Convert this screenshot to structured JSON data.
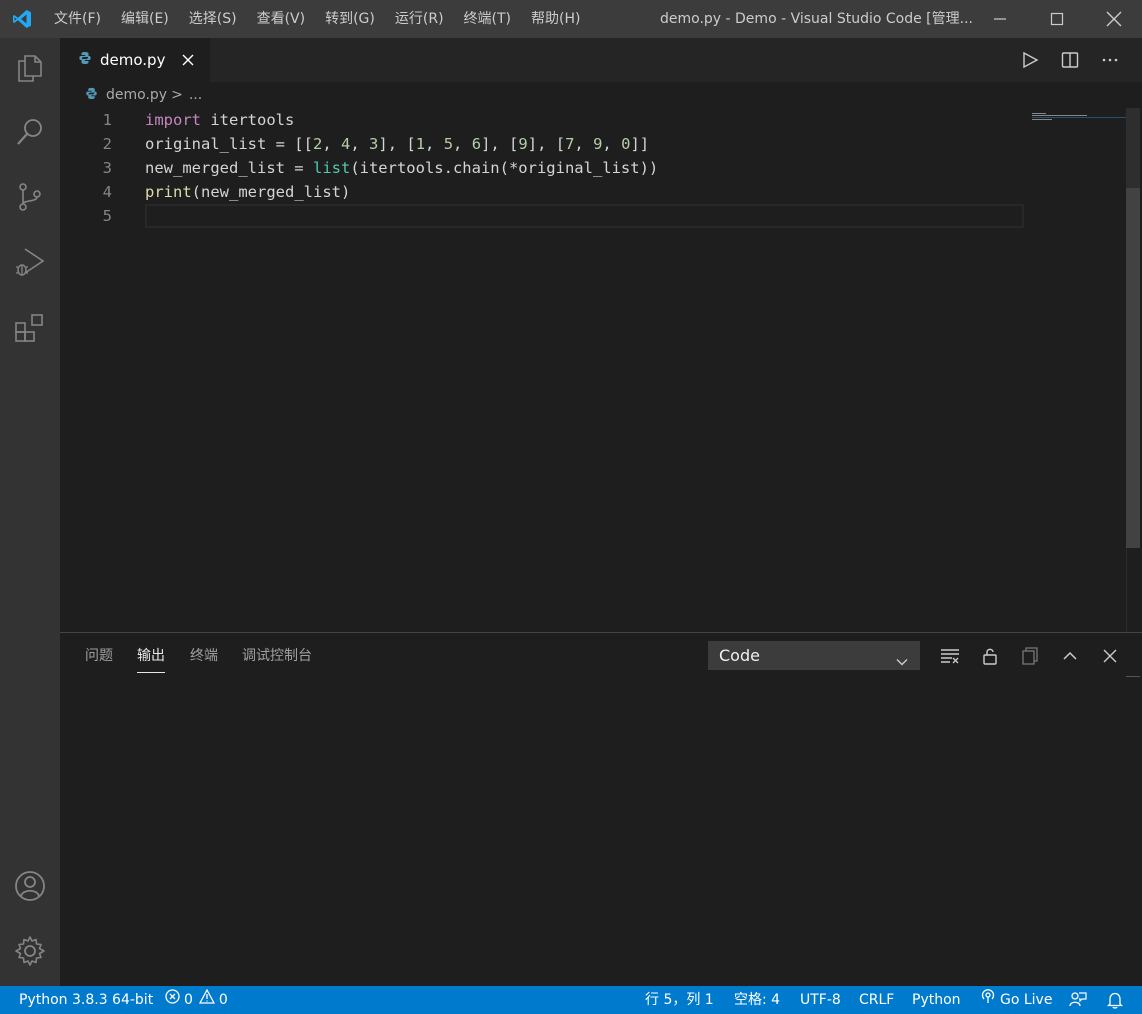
{
  "window": {
    "title": "demo.py - Demo - Visual Studio Code [管理..."
  },
  "menu": [
    "文件(F)",
    "编辑(E)",
    "选择(S)",
    "查看(V)",
    "转到(G)",
    "运行(R)",
    "终端(T)",
    "帮助(H)"
  ],
  "activity_bar": [
    "explorer-icon",
    "search-icon",
    "source-control-icon",
    "run-debug-icon",
    "extensions-icon",
    "account-icon",
    "manage-gear-icon"
  ],
  "tab": {
    "label": "demo.py"
  },
  "breadcrumb": {
    "file": "demo.py",
    "sep": ">",
    "more": "..."
  },
  "editor": {
    "line_numbers": [
      "1",
      "2",
      "3",
      "4",
      "5"
    ],
    "lines": [
      [
        {
          "t": "import",
          "c": "kw-imp"
        },
        {
          "t": " itertools",
          "c": ""
        }
      ],
      [
        {
          "t": "original_list = [[",
          "c": ""
        },
        {
          "t": "2",
          "c": "num"
        },
        {
          "t": ", ",
          "c": ""
        },
        {
          "t": "4",
          "c": "num"
        },
        {
          "t": ", ",
          "c": ""
        },
        {
          "t": "3",
          "c": "num"
        },
        {
          "t": "], [",
          "c": ""
        },
        {
          "t": "1",
          "c": "num"
        },
        {
          "t": ", ",
          "c": ""
        },
        {
          "t": "5",
          "c": "num"
        },
        {
          "t": ", ",
          "c": ""
        },
        {
          "t": "6",
          "c": "num"
        },
        {
          "t": "], [",
          "c": ""
        },
        {
          "t": "9",
          "c": "num"
        },
        {
          "t": "], [",
          "c": ""
        },
        {
          "t": "7",
          "c": "num"
        },
        {
          "t": ", ",
          "c": ""
        },
        {
          "t": "9",
          "c": "num"
        },
        {
          "t": ", ",
          "c": ""
        },
        {
          "t": "0",
          "c": "num"
        },
        {
          "t": "]]",
          "c": ""
        }
      ],
      [
        {
          "t": "new_merged_list = ",
          "c": ""
        },
        {
          "t": "list",
          "c": "kw-fn"
        },
        {
          "t": "(itertools.chain(*original_list))",
          "c": ""
        }
      ],
      [
        {
          "t": "print",
          "c": "kw-call"
        },
        {
          "t": "(new_merged_list)",
          "c": ""
        }
      ],
      []
    ]
  },
  "panel": {
    "tabs": [
      "问题",
      "输出",
      "终端",
      "调试控制台"
    ],
    "active_tab": "输出",
    "channel_select": "Code"
  },
  "statusbar": {
    "interpreter": "Python 3.8.3 64-bit",
    "errors": "0",
    "warnings": "0",
    "cursor": "行 5，列 1",
    "spaces": "空格: 4",
    "encoding": "UTF-8",
    "eol": "CRLF",
    "language": "Python",
    "golive": "Go Live"
  },
  "colors": {
    "accent": "#007acc",
    "keyword_import": "#c586c0",
    "builtin_type": "#4ec9b0",
    "function": "#dcdcaa",
    "number": "#b5cea8"
  }
}
